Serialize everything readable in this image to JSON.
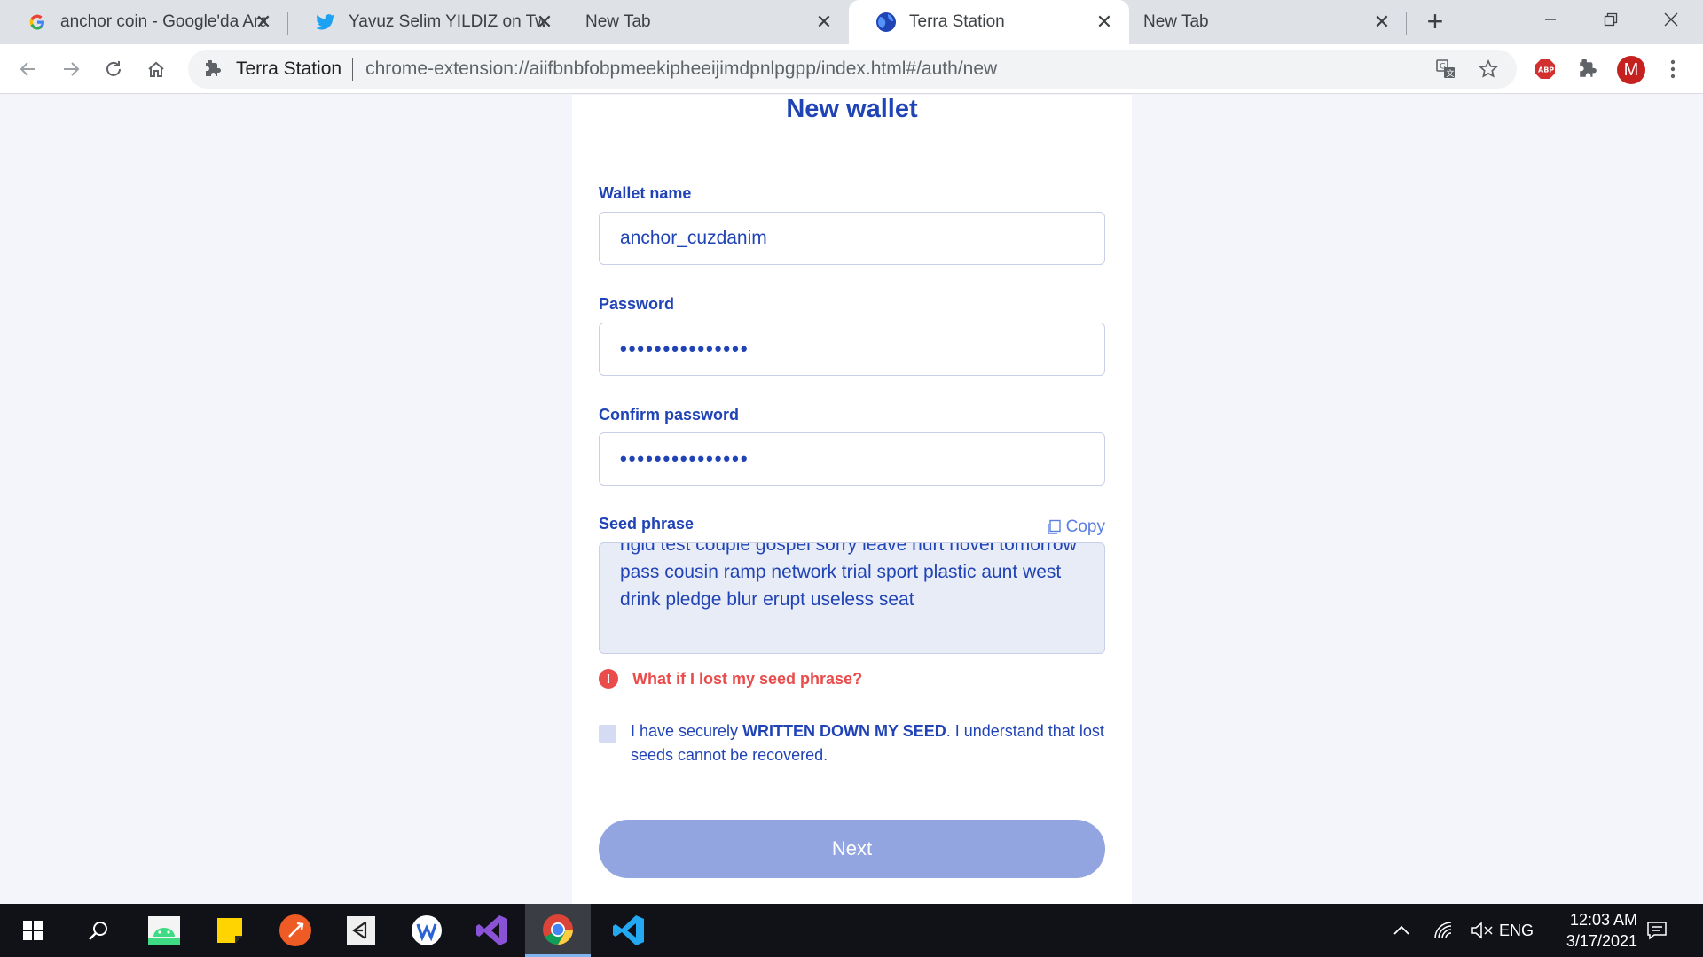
{
  "browser": {
    "tabs": [
      {
        "title": "anchor coin - Google'da Ara",
        "favicon": "google-icon",
        "active": false
      },
      {
        "title": "Yavuz Selim YILDIZ on Twitter",
        "favicon": "twitter-icon",
        "active": false
      },
      {
        "title": "New Tab",
        "favicon": "",
        "active": false
      },
      {
        "title": "Terra Station",
        "favicon": "terra-globe-icon",
        "active": true
      },
      {
        "title": "New Tab",
        "favicon": "",
        "active": false
      }
    ],
    "omnibox": {
      "site_name": "Terra Station",
      "url": "chrome-extension://aiifbnbfobpmeekipheeijimdpnlpgpp/index.html#/auth/new"
    },
    "profile_initial": "M"
  },
  "form": {
    "title": "New wallet",
    "wallet_name": {
      "label": "Wallet name",
      "value": "anchor_cuzdanim"
    },
    "password": {
      "label": "Password",
      "value": "•••••••••••••••"
    },
    "confirm_password": {
      "label": "Confirm password",
      "value": "•••••••••••••••"
    },
    "seed": {
      "label": "Seed phrase",
      "copy_label": "Copy",
      "text": "rigid test couple gospel sorry leave hurt novel tomorrow pass cousin ramp network trial sport plastic aunt west drink pledge blur erupt useless seat"
    },
    "warning_link": "What if I lost my seed phrase?",
    "confirm_checkbox": {
      "text_before": "I have securely ",
      "text_bold": "WRITTEN DOWN MY SEED",
      "text_after": ". I understand that lost seeds cannot be recovered.",
      "checked": false
    },
    "next_label": "Next"
  },
  "taskbar": {
    "apps": [
      "start-icon",
      "search-icon",
      "android-studio-icon",
      "sticky-notes-icon",
      "postman-icon",
      "unity-icon",
      "wps-icon",
      "visual-studio-icon",
      "chrome-icon",
      "vscode-icon"
    ],
    "language": "ENG",
    "time": "12:03 AM",
    "date": "3/17/2021"
  },
  "colors": {
    "brand_blue": "#2043b5",
    "warning_red": "#ea4c4c",
    "next_disabled": "#93a5e0"
  }
}
